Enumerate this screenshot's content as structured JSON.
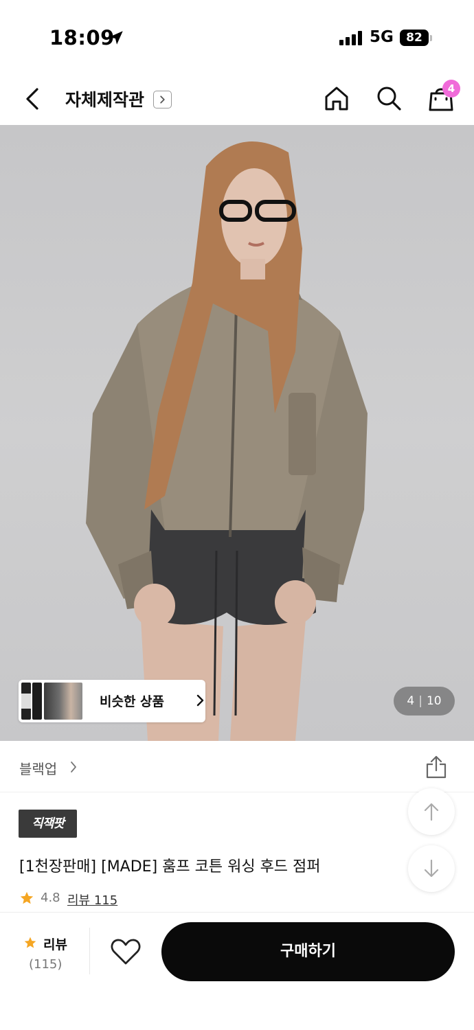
{
  "status_bar": {
    "time": "18:09",
    "network": "5G",
    "battery": "82",
    "icons": [
      "location-arrow-icon",
      "signal-bars-icon",
      "battery-icon"
    ]
  },
  "header": {
    "title": "자체제작관",
    "cart_count": "4",
    "icons": [
      "chevron-left-icon",
      "chevron-right-icon",
      "home-icon",
      "search-icon",
      "shopping-bag-icon"
    ]
  },
  "gallery": {
    "similar_label": "비슷한 상품",
    "current_page": "4",
    "total_pages": "10",
    "image_description": "model wearing washed cotton hooded jumper"
  },
  "brand": {
    "name": "블랙업",
    "icons": [
      "chevron-right-icon",
      "share-icon"
    ]
  },
  "product": {
    "badge": "직잭팟",
    "name": "[1천장판매] [MADE] 훔프 코튼 워싱 후드 점퍼",
    "rating": "4.8",
    "review_link": "리뷰 115"
  },
  "floating": {
    "icons": [
      "arrow-up-icon",
      "arrow-down-icon"
    ]
  },
  "bottom_bar": {
    "review_label": "리뷰",
    "review_count": "(115)",
    "buy_label": "구매하기",
    "icons": [
      "star-icon",
      "heart-icon"
    ]
  },
  "colors": {
    "accent_pink": "#f06bd9",
    "star": "#f5a623",
    "primary_button": "#0a0a0a"
  }
}
